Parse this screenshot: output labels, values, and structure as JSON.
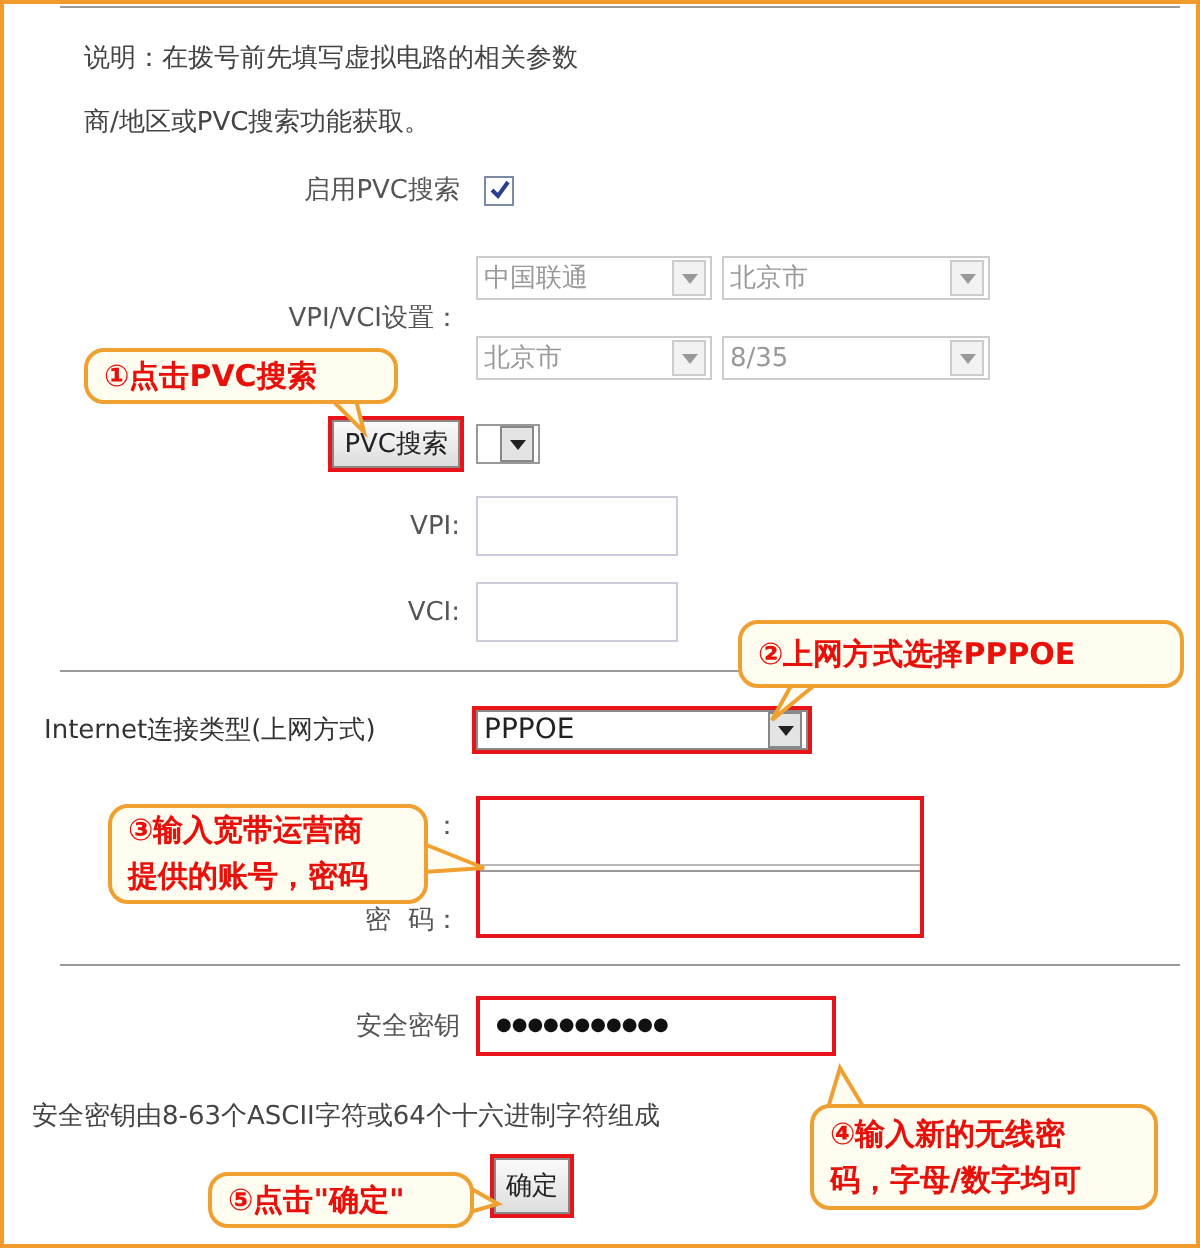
{
  "intro": [
    "说明：在拨号前先填写虚拟电路的相关参数",
    "商/地区或PVC搜索功能获取。"
  ],
  "pvc_search": {
    "label": "启用PVC搜索",
    "checked": true
  },
  "vpi_vci": {
    "label": "VPI/VCI设置：",
    "selects": [
      {
        "value": "中国联通",
        "disabled": true
      },
      {
        "value": "北京市",
        "disabled": true
      },
      {
        "value": "北京市",
        "disabled": true
      },
      {
        "value": "8/35",
        "disabled": true
      }
    ]
  },
  "pvc_button": "PVC搜索",
  "vpi": {
    "label": "VPI:"
  },
  "vci": {
    "label": "VCI:"
  },
  "connection_type": {
    "label": "Internet连接类型(上网方式)",
    "value": "PPPOE"
  },
  "account": {
    "username_label": "：",
    "password_label": "密  码："
  },
  "security_key": {
    "label": "安全密钥",
    "value": "●●●●●●●●●●●"
  },
  "key_hint": "安全密钥由8-63个ASCII字符或64个十六进制字符组成",
  "ok_button": "确定",
  "callouts": [
    {
      "lines": [
        "①点击PVC搜索"
      ]
    },
    {
      "lines": [
        "②上网方式选择PPPOE"
      ]
    },
    {
      "lines": [
        "③输入宽带运营商",
        "提供的账号，密码"
      ]
    },
    {
      "lines": [
        "④输入新的无线密",
        "码，字母/数字均可"
      ]
    },
    {
      "lines": [
        "⑤点击\"确定\""
      ]
    }
  ]
}
